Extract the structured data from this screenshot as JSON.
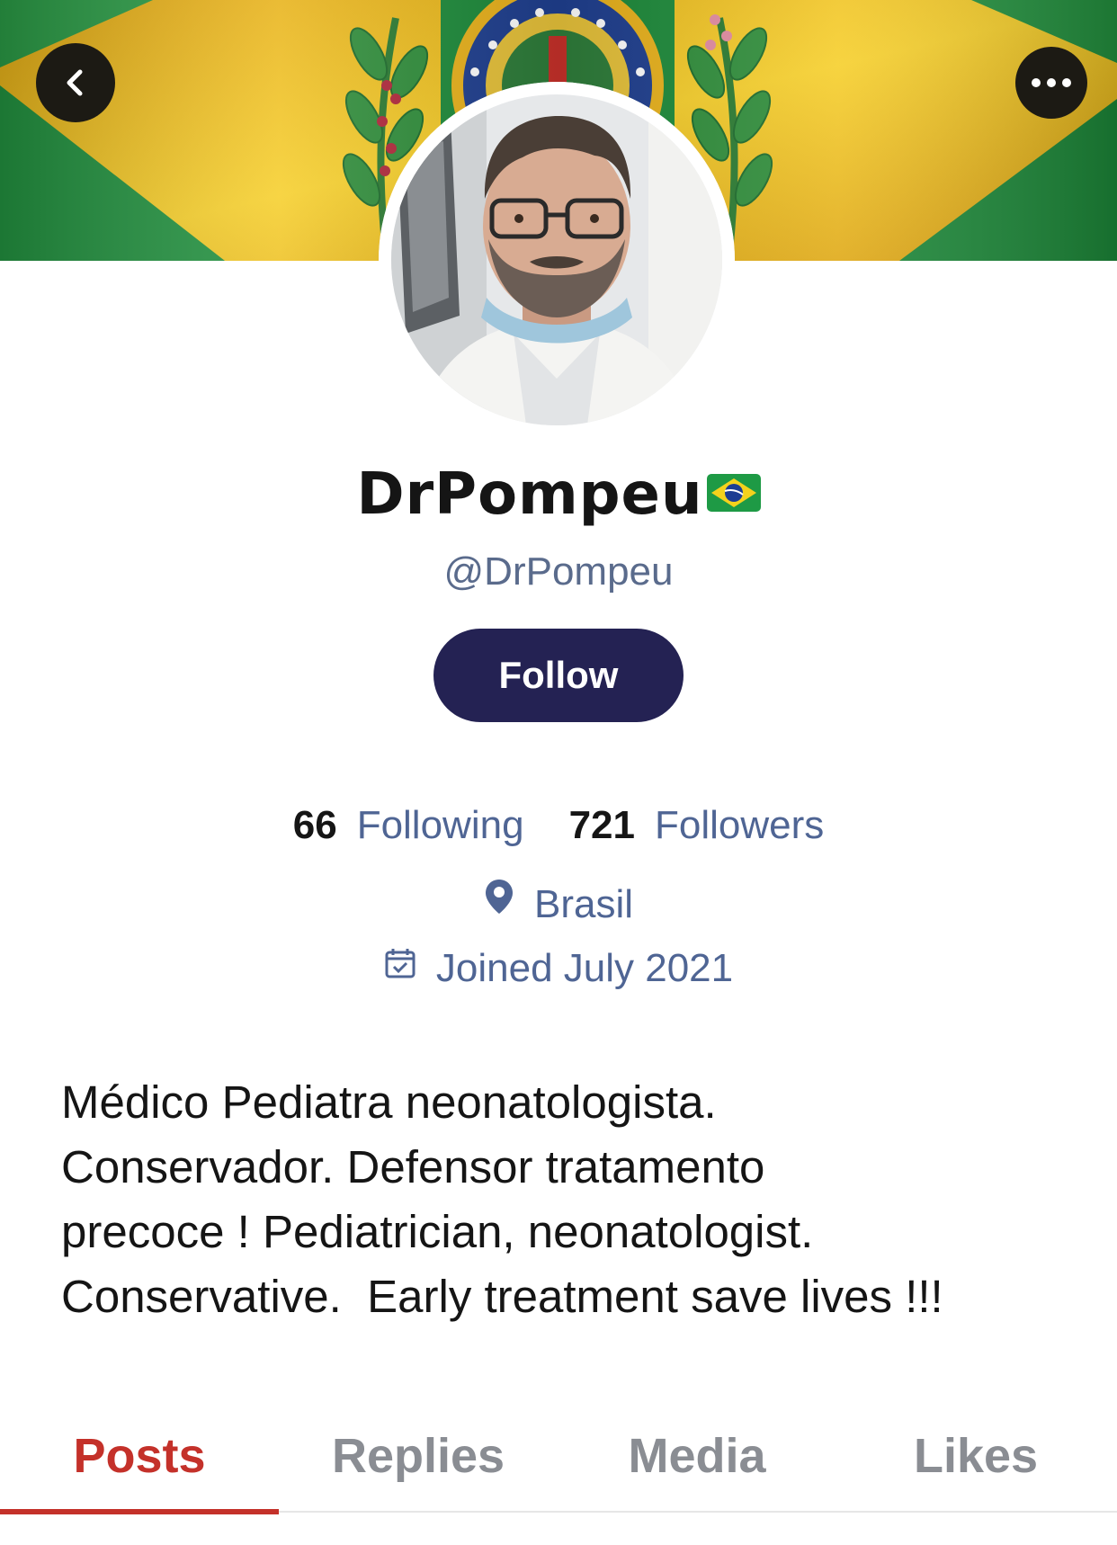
{
  "header": {
    "back_icon": "chevron-left-icon",
    "more_icon": "ellipsis-icon",
    "banner_image": "brazil-flag-banner"
  },
  "profile": {
    "display_name": "DrPompeu",
    "name_emoji_icon": "brazil-flag-emoji",
    "handle": "@DrPompeu",
    "follow_label": "Follow",
    "avatar_icon": "profile-photo-avatar"
  },
  "stats": {
    "following_count": "66",
    "following_label": "Following",
    "followers_count": "721",
    "followers_label": "Followers"
  },
  "meta": {
    "location": "Brasil",
    "location_icon": "map-pin-icon",
    "joined": "Joined July 2021",
    "joined_icon": "calendar-icon"
  },
  "bio": "Médico Pediatra neonatologista.\nConservador. Defensor tratamento\nprecoce ! Pediatrician, neonatologist.\nConservative.  Early treatment save lives !!!",
  "tabs": [
    {
      "label": "Posts",
      "active": true
    },
    {
      "label": "Replies",
      "active": false
    },
    {
      "label": "Media",
      "active": false
    },
    {
      "label": "Likes",
      "active": false
    }
  ],
  "colors": {
    "follow_button": "#242253",
    "accent_tab": "#c4312a",
    "secondary_text": "#4f6594",
    "flag_green": "#1e8f3e",
    "flag_yellow": "#f2c31a"
  }
}
